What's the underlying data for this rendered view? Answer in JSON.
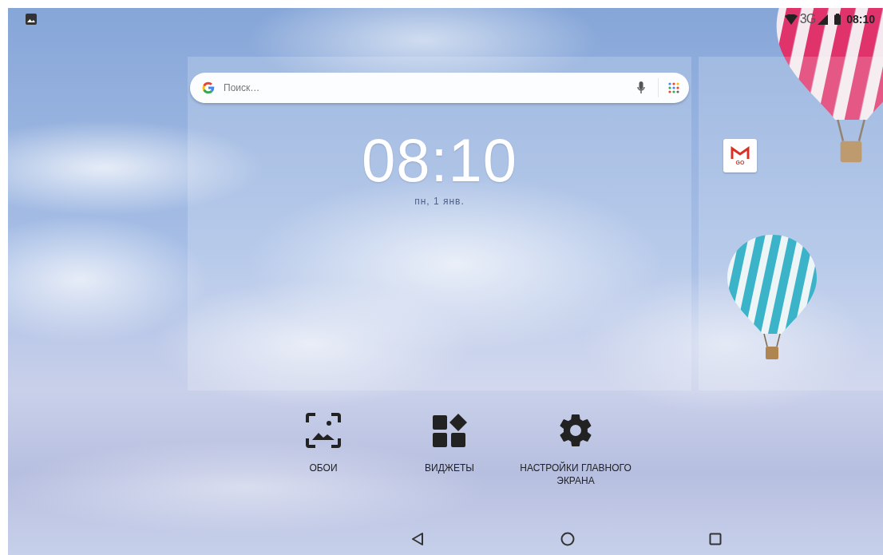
{
  "status_bar": {
    "network": "3G",
    "clock": "08:10"
  },
  "search": {
    "placeholder": "Поиск…"
  },
  "clock_widget": {
    "time": "08:10",
    "date": "пн, 1 янв."
  },
  "app_icon": {
    "badge": "GO"
  },
  "options": [
    {
      "kind": "wallpaper",
      "label": "ОБОИ"
    },
    {
      "kind": "widgets",
      "label": "ВИДЖЕТЫ"
    },
    {
      "kind": "settings",
      "label": "НАСТРОЙКИ ГЛАВНОГО ЭКРАНА"
    }
  ],
  "nav_bar": [
    {
      "kind": "back"
    },
    {
      "kind": "home"
    },
    {
      "kind": "recents"
    }
  ]
}
